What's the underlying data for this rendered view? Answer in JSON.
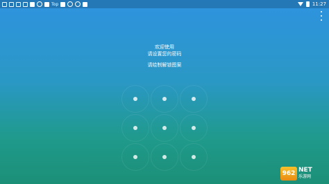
{
  "statusbar": {
    "left_text": "Top",
    "time": "11:27"
  },
  "screen": {
    "welcome_line1": "欢迎使用",
    "welcome_line2": "请设置您的密码",
    "pattern_hint": "请绘制解锁图案"
  },
  "watermark": {
    "logo_text": "962",
    "net_text": "NET",
    "cn_text": "乐游网"
  }
}
